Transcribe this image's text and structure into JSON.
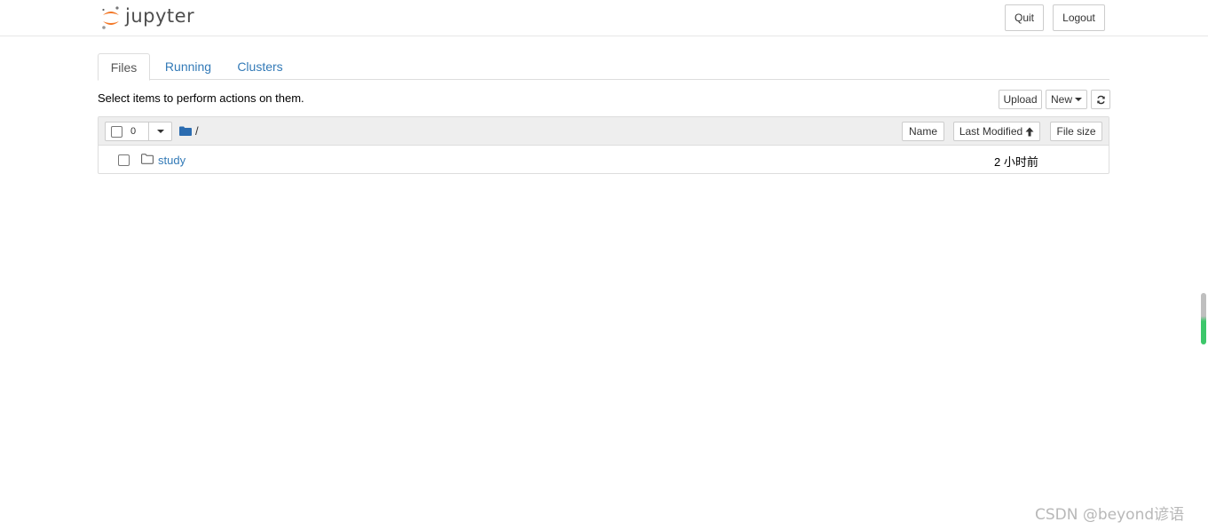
{
  "header": {
    "logo_text": "jupyter",
    "quit_label": "Quit",
    "logout_label": "Logout"
  },
  "tabs": [
    {
      "label": "Files",
      "active": true
    },
    {
      "label": "Running",
      "active": false
    },
    {
      "label": "Clusters",
      "active": false
    }
  ],
  "toolbar": {
    "instructions": "Select items to perform actions on them.",
    "upload_label": "Upload",
    "new_label": "New",
    "refresh_icon": "refresh-icon"
  },
  "list": {
    "selected_count": "0",
    "breadcrumb_path": "/",
    "columns": {
      "name": "Name",
      "last_modified": "Last Modified",
      "file_size": "File size"
    },
    "items": [
      {
        "name": "study",
        "type": "folder",
        "last_modified": "2 小时前",
        "file_size": ""
      }
    ]
  },
  "watermark": "CSDN @beyond谚语",
  "colors": {
    "link": "#337ab7",
    "logo_orange": "#f37726",
    "header_bg": "#eeeeee"
  }
}
